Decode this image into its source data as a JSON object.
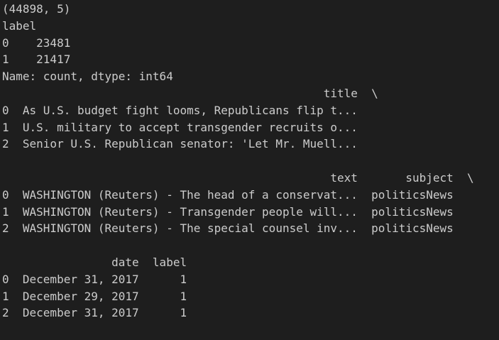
{
  "output_lines": [
    "(44898, 5)",
    "label",
    "0    23481",
    "1    21417",
    "Name: count, dtype: int64",
    "                                               title  \\",
    "0  As U.S. budget fight looms, Republicans flip t...",
    "1  U.S. military to accept transgender recruits o...",
    "2  Senior U.S. Republican senator: 'Let Mr. Muell...",
    "",
    "                                                text       subject  \\",
    "0  WASHINGTON (Reuters) - The head of a conservat...  politicsNews",
    "1  WASHINGTON (Reuters) - Transgender people will...  politicsNews",
    "2  WASHINGTON (Reuters) - The special counsel inv...  politicsNews",
    "",
    "                date  label",
    "0  December 31, 2017      1",
    "1  December 29, 2017      1",
    "2  December 31, 2017      1"
  ]
}
